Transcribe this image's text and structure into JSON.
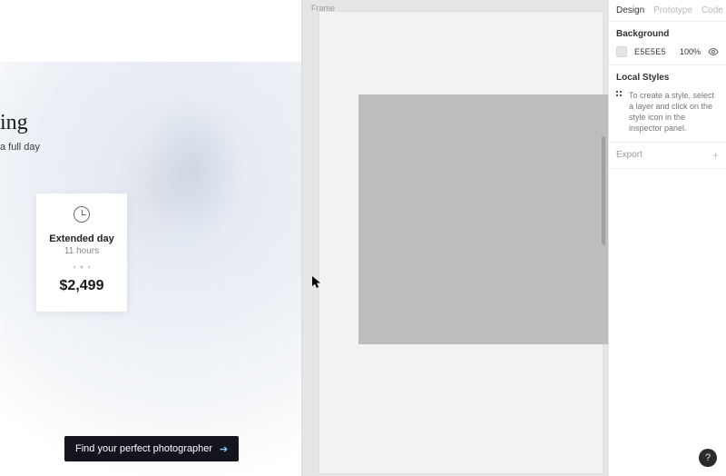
{
  "left": {
    "title_fragment": "ing",
    "subtitle_fragment": "a full day",
    "card": {
      "plan_name": "Extended day",
      "plan_hours": "11 hours",
      "price": "$2,499"
    },
    "cta_label": "Find your perfect photographer"
  },
  "canvas": {
    "frame_label": "Frame"
  },
  "inspector": {
    "tabs": {
      "design": "Design",
      "prototype": "Prototype",
      "code": "Code"
    },
    "background": {
      "title": "Background",
      "hex": "E5E5E5",
      "opacity": "100%"
    },
    "local_styles": {
      "title": "Local Styles",
      "hint": "To create a style, select a layer and click on the style icon in the inspector panel."
    },
    "export_label": "Export"
  },
  "help_label": "?"
}
